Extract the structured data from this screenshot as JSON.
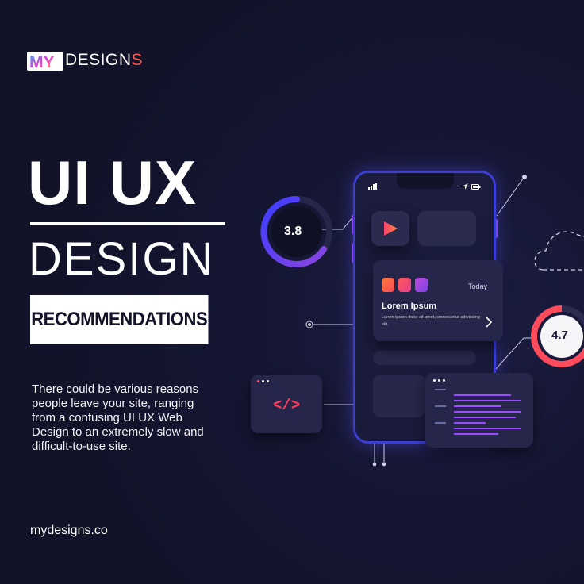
{
  "brand": {
    "mark": "MY",
    "name_main": "DESIGN",
    "name_end": "S"
  },
  "headline": {
    "line1": "UI UX",
    "line2": "DESIGN",
    "tag": "RECOMMENDATIONS"
  },
  "description": "There could be various reasons people leave your site, ranging from a confusing UI UX Web Design to an extremely slow and difficult-to-use site.",
  "website": "mydesigns.co",
  "illustration": {
    "rating_left": "3.8",
    "rating_right": "4.7",
    "card": {
      "date": "Today",
      "title": "Lorem Ipsum",
      "body": "Lorem ipsum dolor sit amet, consectetur adipiscing elit."
    },
    "code_icon": "</>",
    "colors": {
      "accent_purple": "#8a44e0",
      "accent_red": "#ff4b5c",
      "accent_blue": "#3b3fd1"
    }
  }
}
